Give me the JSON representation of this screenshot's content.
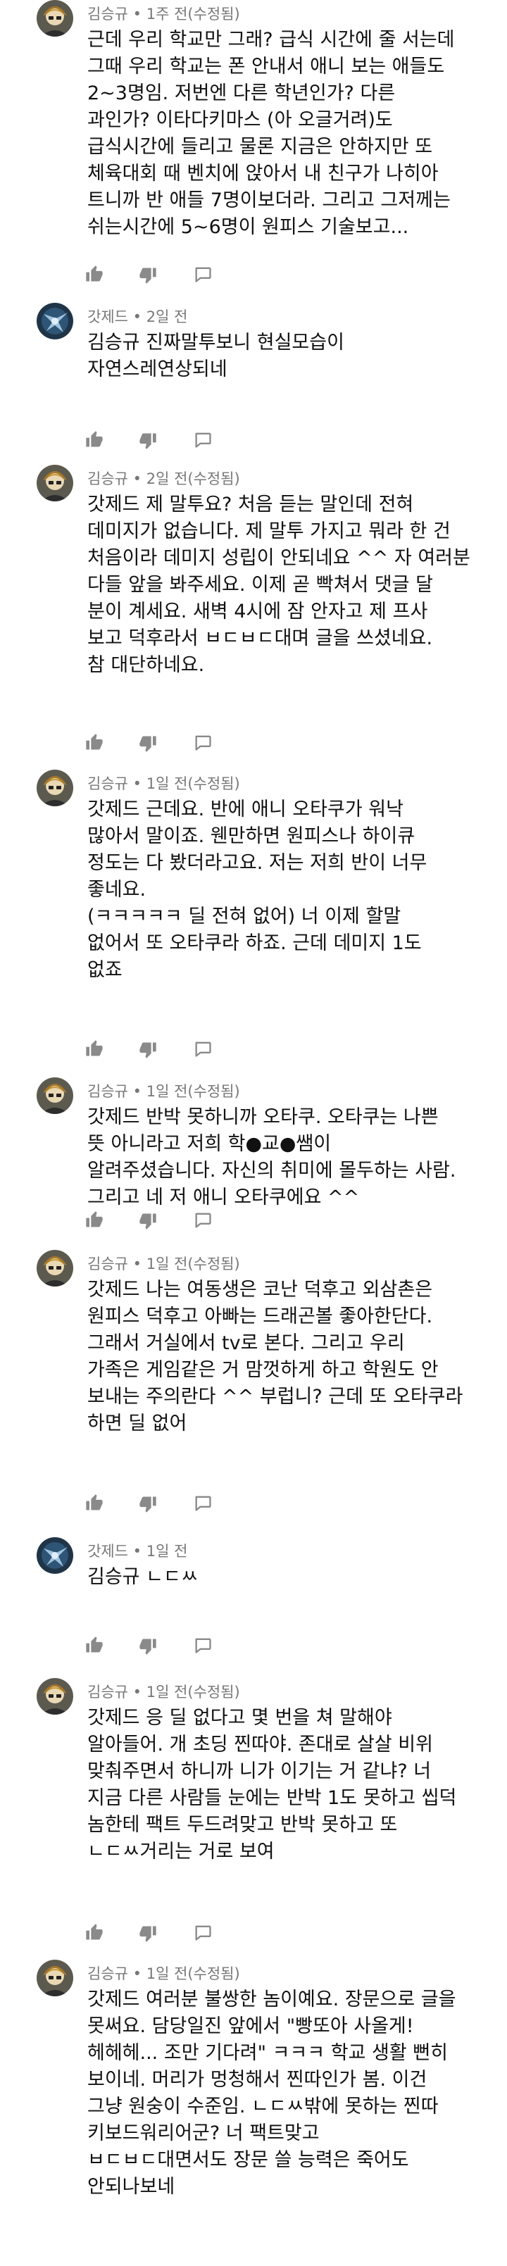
{
  "icons": {
    "like": "thumb-up-icon",
    "dislike": "thumb-down-icon",
    "reply": "reply-icon"
  },
  "colors": {
    "meta_text": "#777777",
    "body_text": "#111111",
    "icon": "#8a8a8a"
  },
  "comments": [
    {
      "author": "김승규",
      "time": "1주 전(수정됨)",
      "lines": [
        "근데 우리 학교만 그래? 급식 시간에 줄 서는데",
        "그때 우리 학교는 폰 안내서 애니 보는 애들도",
        "2~3명임. 저번엔 다른 학년인가? 다른",
        "과인가? 이타다키마스 (아 오글거려)도",
        "급식시간에 들리고 물론 지금은 안하지만 또",
        "체육대회 때 벤치에 앉아서 내 친구가 나히아",
        "트니까 반 애들 7명이보더라. 그리고 그저께는",
        "쉬는시간에 5~6명이 원피스 기술보고..."
      ]
    },
    {
      "author": "갓제드",
      "time": "2일 전",
      "lines": [
        "김승규 진짜말투보니 현실모습이",
        "자연스레연상되네"
      ]
    },
    {
      "author": "김승규",
      "time": "2일 전(수정됨)",
      "lines": [
        "갓제드 제 말투요? 처음 듣는 말인데 전혀",
        "데미지가 없습니다. 제 말투 가지고 뭐라 한 건",
        "처음이라 데미지 성립이 안되네요 ^^ 자 여러분",
        "다들 앞을 봐주세요. 이제 곧 빡쳐서 댓글 달",
        "분이 계세요. 새벽 4시에 잠 안자고 제 프사",
        "보고 덕후라서 ㅂㄷㅂㄷ대며 글을 쓰셨네요.",
        "참 대단하네요."
      ]
    },
    {
      "author": "김승규",
      "time": "1일 전(수정됨)",
      "lines": [
        "갓제드 근데요. 반에 애니 오타쿠가 워낙",
        "많아서 말이죠. 웬만하면 원피스나 하이큐",
        "정도는 다 봤더라고요. 저는 저희 반이 너무",
        "좋네요.",
        "(ㅋㅋㅋㅋㅋ 딜 전혀 없어) 너 이제 할말",
        "없어서 또 오타쿠라 하죠. 근데 데미지 1도",
        "없죠"
      ]
    },
    {
      "author": "김승규",
      "time": "1일 전(수정됨)",
      "lines": [
        "갓제드 반박 못하니까 오타쿠. 오타쿠는 나쁜",
        "뜻 아니라고 저희 학●교●쌤이",
        "알려주셨습니다. 자신의 취미에 몰두하는 사람.",
        "그리고 네 저 애니 오타쿠에요 ^^"
      ]
    },
    {
      "author": "김승규",
      "time": "1일 전(수정됨)",
      "lines": [
        "갓제드 나는 여동생은 코난 덕후고 외삼촌은",
        "원피스 덕후고 아빠는 드래곤볼 좋아한단다.",
        "그래서 거실에서 tv로 본다. 그리고 우리",
        "가족은 게임같은 거 맘껏하게 하고 학원도 안",
        "보내는 주의란다 ^^ 부럽니? 근데 또 오타쿠라",
        "하면 딜 없어"
      ]
    },
    {
      "author": "갓제드",
      "time": "1일 전",
      "lines": [
        "김승규 ㄴㄷㅆ"
      ]
    },
    {
      "author": "김승규",
      "time": "1일 전(수정됨)",
      "lines": [
        "갓제드 응 딜 없다고 몇 번을 쳐 말해야",
        "알아들어. 개 초딩 찐따야. 존대로 살살 비위",
        "맞춰주면서 하니까 니가 이기는 거 같냐? 너",
        "지금 다른 사람들 눈에는 반박 1도 못하고 씹덕",
        "놈한테 팩트 두드려맞고 반박 못하고 또",
        "ㄴㄷㅆ거리는 거로 보여"
      ]
    },
    {
      "author": "김승규",
      "time": "1일 전(수정됨)",
      "lines": [
        "갓제드 여러분 불쌍한 놈이예요. 장문으로 글을",
        "못써요. 담당일진 앞에서 \"빵또아 사올게!",
        "헤헤헤... 조만 기다려\" ㅋㅋㅋ 학교 생활 뻔히",
        "보이네. 머리가 멍청해서 찐따인가 봄. 이건",
        "그냥 원숭이 수준임. ㄴㄷㅆ밖에 못하는 찐따",
        "키보드워리어군? 너 팩트맞고",
        "ㅂㄷㅂㄷ대면서도 장문 쓸 능력은 죽어도",
        "안되나보네"
      ]
    }
  ]
}
